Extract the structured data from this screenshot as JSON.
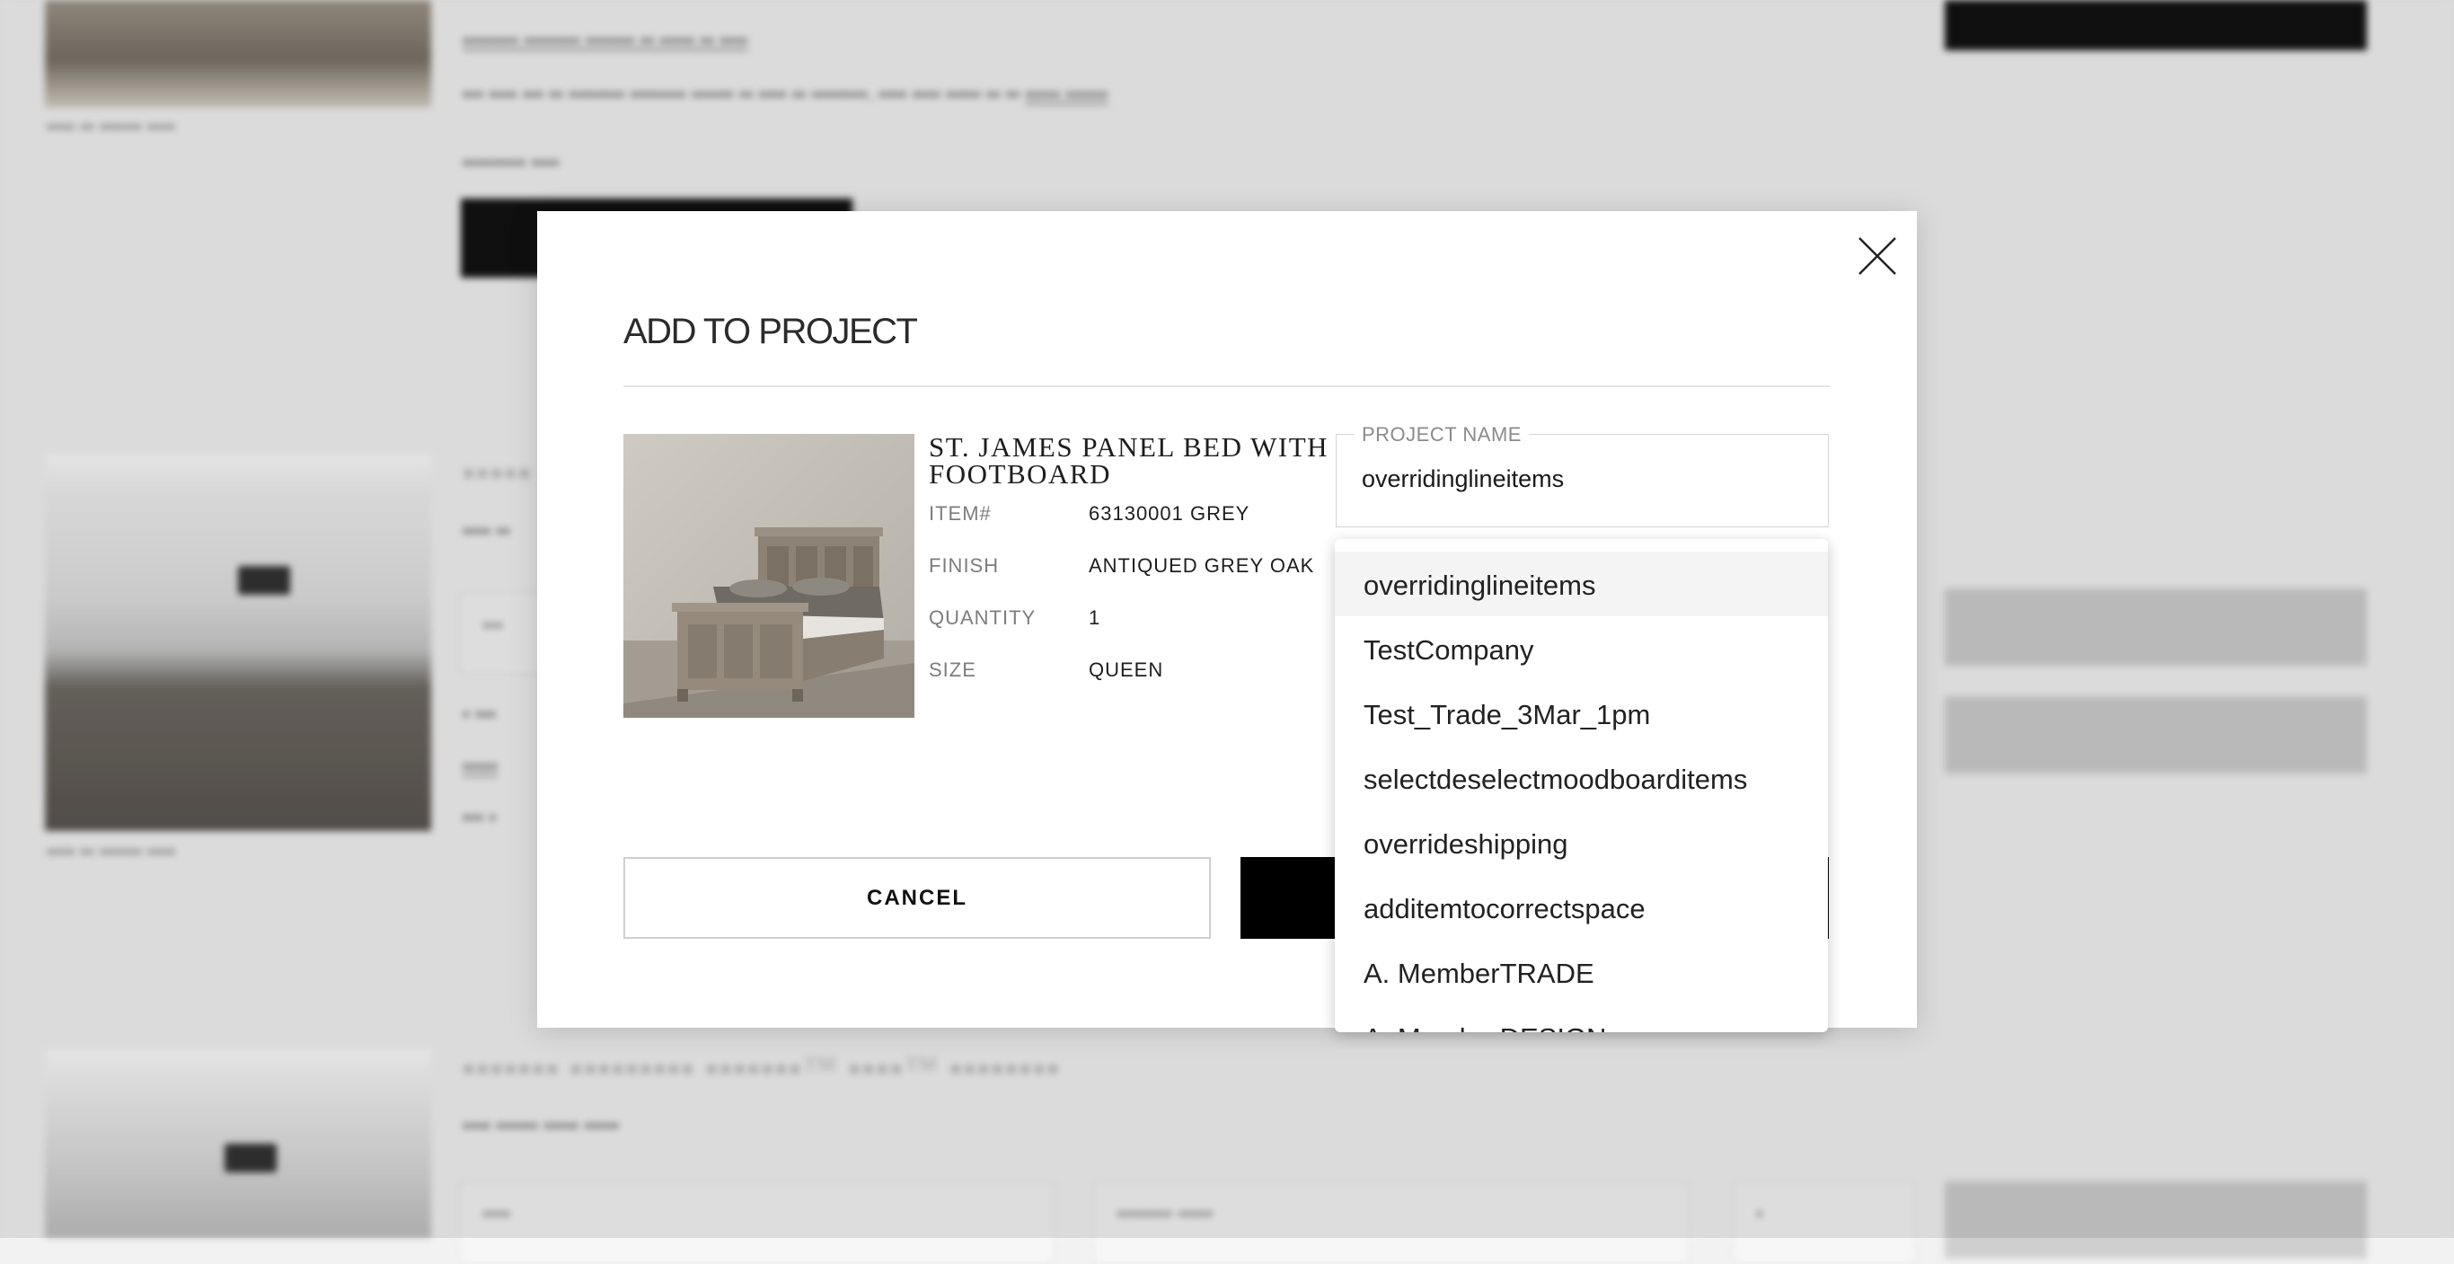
{
  "modal": {
    "title": "ADD TO PROJECT",
    "product": {
      "name": "ST. JAMES PANEL BED WITH FOOTBOARD",
      "specs": [
        {
          "label": "ITEM#",
          "value": "63130001 GREY"
        },
        {
          "label": "FINISH",
          "value": "ANTIQUED GREY OAK"
        },
        {
          "label": "QUANTITY",
          "value": "1"
        },
        {
          "label": "SIZE",
          "value": "QUEEN"
        }
      ]
    },
    "project_field": {
      "label": "PROJECT NAME",
      "value": "overridinglineitems"
    },
    "cancel_label": "CANCEL"
  },
  "dropdown": {
    "selected_index": 0,
    "options": [
      "overridinglineitems",
      "TestCompany",
      "Test_Trade_3Mar_1pm",
      "selectdeselectmoodboarditems",
      "overrideshipping",
      "additemtocorrectspace",
      "A. MemberTRADE",
      "A. MemberDESIGN"
    ]
  },
  "colors": {
    "overlay": "#000000",
    "primary_button": "#000000",
    "active_option": "#f4f4f4"
  }
}
